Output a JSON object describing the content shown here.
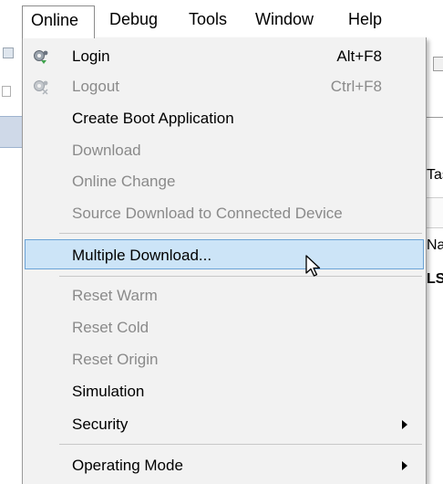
{
  "menubar": {
    "items": [
      "Online",
      "Debug",
      "Tools",
      "Window",
      "Help"
    ],
    "active": "Online"
  },
  "background": {
    "tab_fragment": "Tas",
    "label_fragment_1": "Na",
    "label_fragment_2": "LS"
  },
  "menu": {
    "items": [
      {
        "label": "Login",
        "shortcut": "Alt+F8",
        "enabled": true,
        "icon": "login-gear-icon"
      },
      {
        "label": "Logout",
        "shortcut": "Ctrl+F8",
        "enabled": false,
        "icon": "logout-gear-icon"
      },
      {
        "label": "Create Boot Application",
        "enabled": true
      },
      {
        "label": "Download",
        "enabled": false
      },
      {
        "label": "Online Change",
        "enabled": false
      },
      {
        "label": "Source Download to Connected Device",
        "enabled": false
      },
      {
        "label": "Multiple Download...",
        "enabled": true,
        "highlighted": true
      },
      {
        "label": "Reset Warm",
        "enabled": false
      },
      {
        "label": "Reset Cold",
        "enabled": false
      },
      {
        "label": "Reset Origin",
        "enabled": false
      },
      {
        "label": "Simulation",
        "enabled": true
      },
      {
        "label": "Security",
        "enabled": true,
        "submenu": true
      },
      {
        "label": "Operating Mode",
        "enabled": true,
        "submenu": true
      }
    ]
  },
  "colors": {
    "highlight_bg": "#cce4f7",
    "highlight_border": "#6ba3d6",
    "disabled_text": "#8a8a8a",
    "menu_bg": "#f2f2f2"
  }
}
